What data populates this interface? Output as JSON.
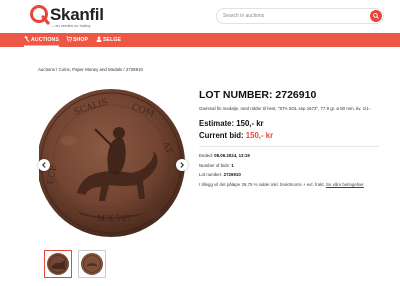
{
  "header": {
    "logo_text": "Skanfil",
    "logo_tagline": "– en verden av hobby",
    "search_placeholder": "Search in auctions"
  },
  "nav": {
    "items": [
      {
        "label": "AUCTIONS",
        "icon": "gavel-icon"
      },
      {
        "label": "SHOP",
        "icon": "cart-icon"
      },
      {
        "label": "SELGE",
        "icon": "user-icon"
      }
    ]
  },
  "breadcrumb": "Auctions / Coins, Paper Money and Medals / 2726910",
  "lot": {
    "title": "LOT NUMBER: 2726910",
    "description": "Gammal fin medalje, med ridder til hest, \"STA SOL sep 1673\", 77.9 gr. ø 50 mm. kv. 1/1-.",
    "estimate_label": "Estimate:",
    "estimate_value": "150,- kr",
    "current_bid_label": "Current bid:",
    "current_bid_value": "150,- kr"
  },
  "details": {
    "ended_label": "Ended:",
    "ended_value": "08.06.2024, 13:19",
    "bids_label": "Number of bids:",
    "bids_value": "1",
    "lot_label": "Lot number:",
    "lot_value": "2726910",
    "fee_text": "I tillegg vil det påløpe 28,75 % salær inkl. bruktmoms + evt. frakt.",
    "fee_link": "Se våre betingelser"
  },
  "colors": {
    "brand": "#e8463a",
    "nav_bg": "#ec5845",
    "coin_base": "#7a4a36",
    "coin_dark": "#4a2a1e"
  }
}
